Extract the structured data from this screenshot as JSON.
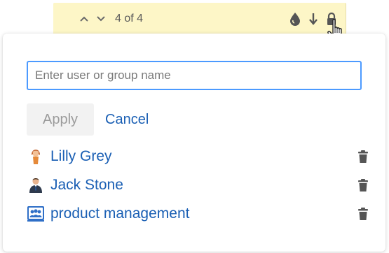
{
  "navigation": {
    "counter": "4 of 4"
  },
  "restrictions": {
    "input_placeholder": "Enter user or group name",
    "apply_label": "Apply",
    "cancel_label": "Cancel",
    "entries": [
      {
        "name": "Lilly Grey",
        "avatar": "female-user-avatar-icon"
      },
      {
        "name": "Jack Stone",
        "avatar": "male-user-avatar-icon"
      },
      {
        "name": "product management",
        "avatar": "group-icon"
      }
    ]
  },
  "colors": {
    "toolbar_background": "#fdf6c7",
    "link": "#1a5fb4",
    "input_focus_border": "#4c9aff",
    "disabled_button_bg": "#f2f2f2",
    "disabled_button_text": "#9b9b9b",
    "icon_gray": "#555555"
  }
}
